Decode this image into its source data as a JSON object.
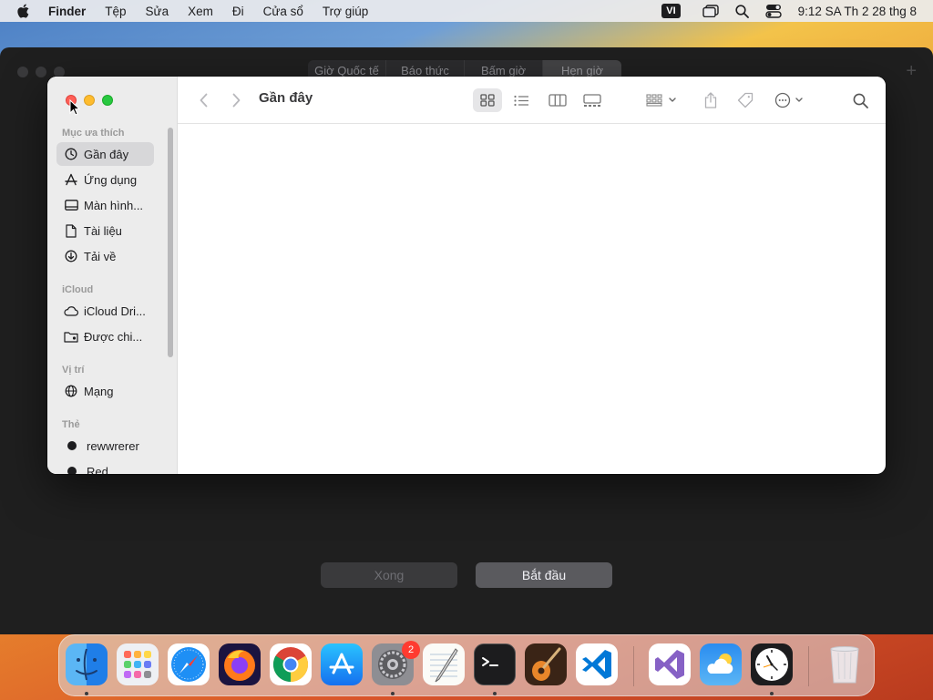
{
  "menubar": {
    "app_name": "Finder",
    "items": [
      "Tệp",
      "Sửa",
      "Xem",
      "Đi",
      "Cửa sổ",
      "Trợ giúp"
    ],
    "input_source": "VI",
    "clock": "9:12 SA Th 2 28 thg 8"
  },
  "clock_app": {
    "tabs": [
      "Giờ Quốc tế",
      "Báo thức",
      "Bấm giờ",
      "Hẹn giờ"
    ],
    "done_button": "Xong",
    "start_button": "Bắt đầu"
  },
  "finder": {
    "title": "Gần đây",
    "sidebar": {
      "favorites_heading": "Mục ưa thích",
      "favorites": [
        {
          "label": "Gần đây",
          "icon": "clock-icon"
        },
        {
          "label": "Ứng dụng",
          "icon": "apps-icon"
        },
        {
          "label": "Màn hình...",
          "icon": "desktop-icon"
        },
        {
          "label": "Tài liệu",
          "icon": "document-icon"
        },
        {
          "label": "Tải về",
          "icon": "download-icon"
        }
      ],
      "icloud_heading": "iCloud",
      "icloud": [
        {
          "label": "iCloud Dri...",
          "icon": "cloud-icon"
        },
        {
          "label": "Được chi...",
          "icon": "shared-folder-icon"
        }
      ],
      "locations_heading": "Vị trí",
      "locations": [
        {
          "label": "Mạng",
          "icon": "globe-icon"
        }
      ],
      "tags_heading": "Thẻ",
      "tags": [
        {
          "label": "rewwrerer",
          "color": "#1d1d1f"
        },
        {
          "label": "Red",
          "color": "#1d1d1f"
        }
      ]
    }
  },
  "dock": {
    "apps": [
      "Finder",
      "Launchpad",
      "Safari",
      "Firefox",
      "Chrome",
      "App Store",
      "System Settings",
      "TextEdit",
      "Terminal",
      "GarageBand",
      "Visual Studio Code",
      "Visual Studio",
      "Weather",
      "Clock",
      "Trash"
    ],
    "badges": {
      "system_settings": "2"
    }
  },
  "colors": {
    "accent_red": "#ff5f57",
    "accent_yellow": "#febc2e",
    "accent_green": "#28c840",
    "sidebar_bg": "#ececec",
    "badge_red": "#ff3b30"
  }
}
